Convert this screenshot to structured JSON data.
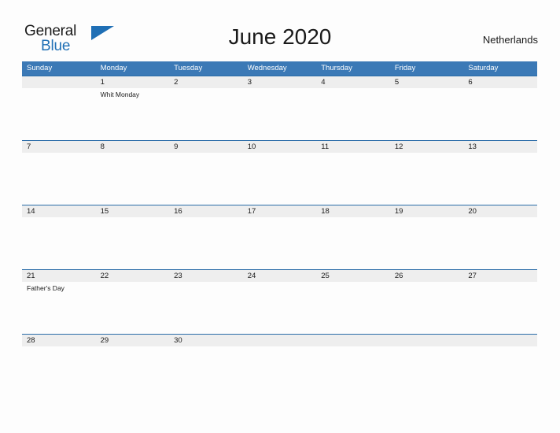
{
  "logo": {
    "word_one": "General",
    "word_two": "Blue",
    "mark_icon": "blue-triangle-icon",
    "brand_blue": "#1f6fb5"
  },
  "header": {
    "title": "June 2020",
    "country": "Netherlands"
  },
  "colors": {
    "header_blue": "#3b79b6",
    "row_divider_blue": "#2a6ca8",
    "date_band_grey": "#eeeeee",
    "page_background": "#fdfdfd",
    "text": "#1a1a1a"
  },
  "calendar": {
    "weekday_headers": [
      "Sunday",
      "Monday",
      "Tuesday",
      "Wednesday",
      "Thursday",
      "Friday",
      "Saturday"
    ],
    "weeks": [
      {
        "days": [
          {
            "number": "",
            "events": []
          },
          {
            "number": "1",
            "events": [
              "Whit Monday"
            ]
          },
          {
            "number": "2",
            "events": []
          },
          {
            "number": "3",
            "events": []
          },
          {
            "number": "4",
            "events": []
          },
          {
            "number": "5",
            "events": []
          },
          {
            "number": "6",
            "events": []
          }
        ]
      },
      {
        "days": [
          {
            "number": "7",
            "events": []
          },
          {
            "number": "8",
            "events": []
          },
          {
            "number": "9",
            "events": []
          },
          {
            "number": "10",
            "events": []
          },
          {
            "number": "11",
            "events": []
          },
          {
            "number": "12",
            "events": []
          },
          {
            "number": "13",
            "events": []
          }
        ]
      },
      {
        "days": [
          {
            "number": "14",
            "events": []
          },
          {
            "number": "15",
            "events": []
          },
          {
            "number": "16",
            "events": []
          },
          {
            "number": "17",
            "events": []
          },
          {
            "number": "18",
            "events": []
          },
          {
            "number": "19",
            "events": []
          },
          {
            "number": "20",
            "events": []
          }
        ]
      },
      {
        "days": [
          {
            "number": "21",
            "events": [
              "Father's Day"
            ]
          },
          {
            "number": "22",
            "events": []
          },
          {
            "number": "23",
            "events": []
          },
          {
            "number": "24",
            "events": []
          },
          {
            "number": "25",
            "events": []
          },
          {
            "number": "26",
            "events": []
          },
          {
            "number": "27",
            "events": []
          }
        ]
      },
      {
        "days": [
          {
            "number": "28",
            "events": []
          },
          {
            "number": "29",
            "events": []
          },
          {
            "number": "30",
            "events": []
          },
          {
            "number": "",
            "events": []
          },
          {
            "number": "",
            "events": []
          },
          {
            "number": "",
            "events": []
          },
          {
            "number": "",
            "events": []
          }
        ]
      }
    ]
  }
}
